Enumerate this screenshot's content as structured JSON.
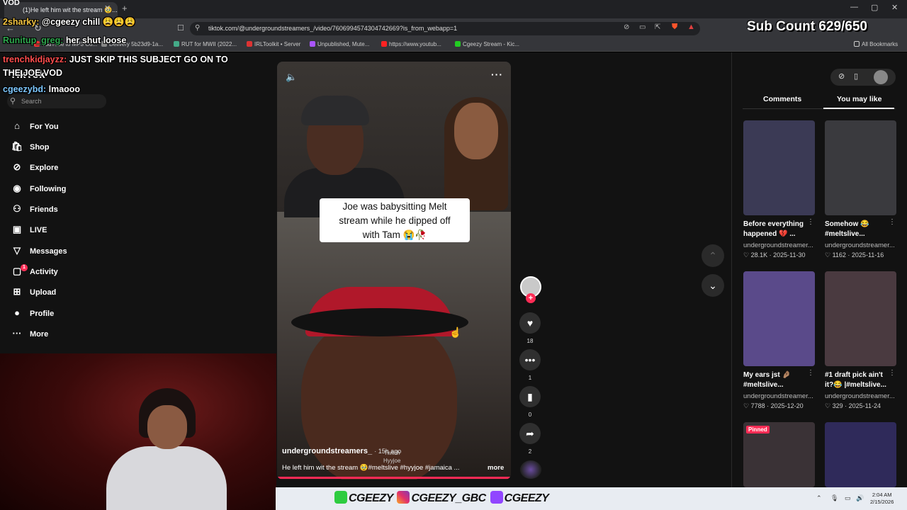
{
  "browser": {
    "tab_title": "(1)He left him wit the stream 🥹...",
    "url": "tiktok.com/@undergroundstreamers_/video/7606994574304742669?is_from_webapp=1",
    "bookmarks": [
      "YouTube to MP3 Co...",
      "Delivery 5b23d9-1a...",
      "RUT for MWII (2022...",
      "IRLToolkit • Server",
      "Unpublished, Mute...",
      "https://www.youtub...",
      "Cgeezy Stream - Kic..."
    ],
    "all_bookmarks": "All Bookmarks"
  },
  "stream": {
    "vod_label": "VOD",
    "sub_count": "Sub Count 629/650",
    "chat": [
      {
        "user": "2sharky:",
        "text": "@cgeezy chill 😩😩😩",
        "color": "#f4c542"
      },
      {
        "user": "Runitup_greg:",
        "text": "her shut loose",
        "color": "#2fa84f"
      },
      {
        "user": "trenchkidjayzz:",
        "text": "JUST SKIP THIS SUBJECT GO ON TO THE JOE VOD",
        "color": "#ff4d4d"
      },
      {
        "user": "cgeezybd:",
        "text": "lmaooo",
        "color": "#7ec8ff"
      }
    ],
    "social_handles": [
      "CGEEZY",
      "CGEEZY_GBC",
      "CGEEZY"
    ]
  },
  "tiktok": {
    "logo": "TikTok",
    "search_placeholder": "Search",
    "nav": [
      {
        "label": "For You",
        "icon": "home-icon",
        "glyph": "⌂"
      },
      {
        "label": "Shop",
        "icon": "shop-icon",
        "glyph": "🛍"
      },
      {
        "label": "Explore",
        "icon": "compass-icon",
        "glyph": "⊘"
      },
      {
        "label": "Following",
        "icon": "following-avatar-icon",
        "glyph": "◉"
      },
      {
        "label": "Friends",
        "icon": "friends-icon",
        "glyph": "⚇"
      },
      {
        "label": "LIVE",
        "icon": "live-icon",
        "glyph": "▣"
      },
      {
        "label": "Messages",
        "icon": "messages-icon",
        "glyph": "▽"
      },
      {
        "label": "Activity",
        "icon": "activity-icon",
        "glyph": "▢"
      },
      {
        "label": "Upload",
        "icon": "upload-icon",
        "glyph": "⊞"
      },
      {
        "label": "Profile",
        "icon": "profile-icon",
        "glyph": "●"
      },
      {
        "label": "More",
        "icon": "more-icon",
        "glyph": "···"
      }
    ],
    "activity_badge": "1",
    "video": {
      "caption_line1": "Joe was babysitting Melt",
      "caption_line2": "stream while he dipped off",
      "caption_line3": "with Tam 😭🥀",
      "author": "undergroundstreamers_",
      "time": "· 15h ago",
      "description": "He left him wit the stream 🥹#meltslive #hyyjoe #jamaica ...",
      "more": "more",
      "overlay_text1": "Twitch",
      "overlay_text2": "Hyyjoe"
    },
    "actions": {
      "likes": "18",
      "comments": "1",
      "saves": "0",
      "shares": "2"
    },
    "right_panel": {
      "tab_comments": "Comments",
      "tab_you_may_like": "You may like",
      "pinned": "Pinned",
      "cards": [
        {
          "title1": "Before everything",
          "title2": "happened 💔 ...",
          "author": "undergroundstreamer...",
          "meta": "♡ 28.1K · 2025-11-30",
          "color": "#3b3a55"
        },
        {
          "title1": "Somehow 😂",
          "title2": "#meltslive...",
          "author": "undergroundstreamer...",
          "meta": "♡ 1162 · 2025-11-16",
          "color": "#3a3a3e"
        },
        {
          "title1": "My ears jst 🤌🏽",
          "title2": "#meltslive...",
          "author": "undergroundstreamer...",
          "meta": "♡ 7788 · 2025-12-20",
          "color": "#5a4a8a"
        },
        {
          "title1": "#1 draft pick ain't",
          "title2": "it?😂 |#meltslive...",
          "author": "undergroundstreamer...",
          "meta": "♡ 329 · 2025-11-24",
          "color": "#4a3a40"
        },
        {
          "title1": "",
          "title2": "",
          "author": "",
          "meta": "",
          "color": "#3a3236"
        },
        {
          "title1": "",
          "title2": "",
          "author": "",
          "meta": "",
          "color": "#2f2a5a"
        }
      ]
    }
  },
  "taskbar": {
    "time": "2:04 AM",
    "date": "2/15/2026"
  }
}
